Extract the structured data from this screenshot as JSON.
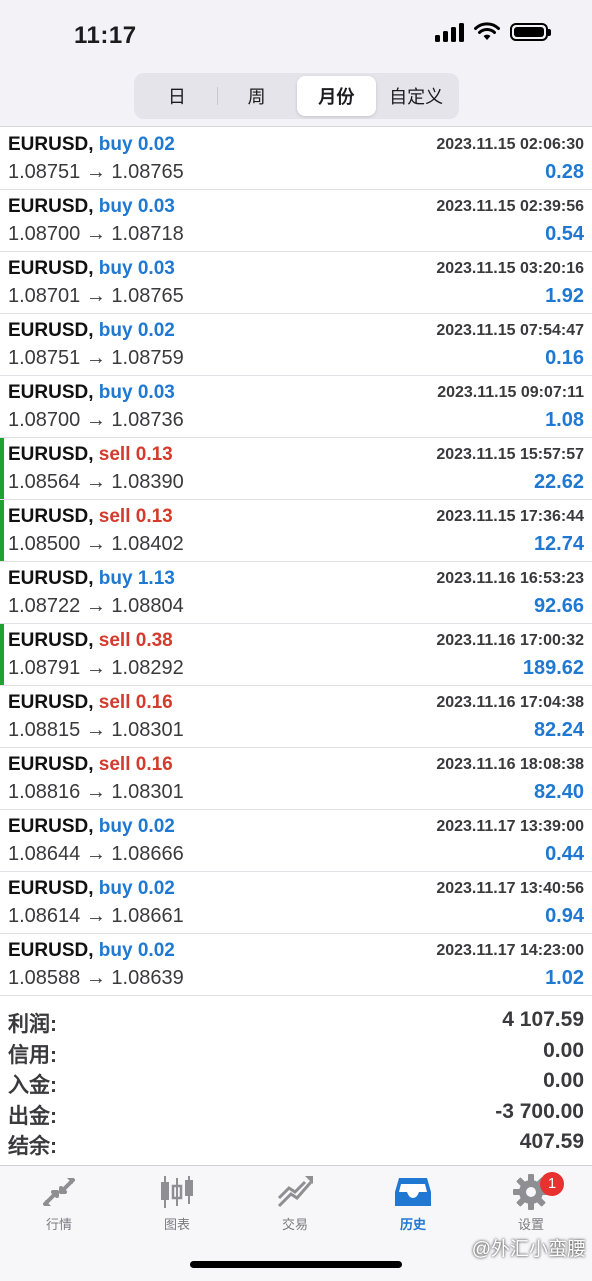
{
  "status": {
    "time": "11:17"
  },
  "segments": [
    "日",
    "周",
    "月份",
    "自定义"
  ],
  "active_segment": "月份",
  "trades": [
    {
      "symbol": "EURUSD,",
      "side": "buy",
      "volume": "0.02",
      "side_label": "buy 0.02",
      "datetime": "2023.11.15 02:06:30",
      "prices": "1.08751 → 1.08765",
      "profit": "0.28",
      "marked": false
    },
    {
      "symbol": "EURUSD,",
      "side": "buy",
      "volume": "0.03",
      "side_label": "buy 0.03",
      "datetime": "2023.11.15 02:39:56",
      "prices": "1.08700 → 1.08718",
      "profit": "0.54",
      "marked": false
    },
    {
      "symbol": "EURUSD,",
      "side": "buy",
      "volume": "0.03",
      "side_label": "buy 0.03",
      "datetime": "2023.11.15 03:20:16",
      "prices": "1.08701 → 1.08765",
      "profit": "1.92",
      "marked": false
    },
    {
      "symbol": "EURUSD,",
      "side": "buy",
      "volume": "0.02",
      "side_label": "buy 0.02",
      "datetime": "2023.11.15 07:54:47",
      "prices": "1.08751 → 1.08759",
      "profit": "0.16",
      "marked": false
    },
    {
      "symbol": "EURUSD,",
      "side": "buy",
      "volume": "0.03",
      "side_label": "buy 0.03",
      "datetime": "2023.11.15 09:07:11",
      "prices": "1.08700 → 1.08736",
      "profit": "1.08",
      "marked": false
    },
    {
      "symbol": "EURUSD,",
      "side": "sell",
      "volume": "0.13",
      "side_label": "sell 0.13",
      "datetime": "2023.11.15 15:57:57",
      "prices": "1.08564 → 1.08390",
      "profit": "22.62",
      "marked": true
    },
    {
      "symbol": "EURUSD,",
      "side": "sell",
      "volume": "0.13",
      "side_label": "sell 0.13",
      "datetime": "2023.11.15 17:36:44",
      "prices": "1.08500 → 1.08402",
      "profit": "12.74",
      "marked": true
    },
    {
      "symbol": "EURUSD,",
      "side": "buy",
      "volume": "1.13",
      "side_label": "buy 1.13",
      "datetime": "2023.11.16 16:53:23",
      "prices": "1.08722 → 1.08804",
      "profit": "92.66",
      "marked": false
    },
    {
      "symbol": "EURUSD,",
      "side": "sell",
      "volume": "0.38",
      "side_label": "sell 0.38",
      "datetime": "2023.11.16 17:00:32",
      "prices": "1.08791 → 1.08292",
      "profit": "189.62",
      "marked": true
    },
    {
      "symbol": "EURUSD,",
      "side": "sell",
      "volume": "0.16",
      "side_label": "sell 0.16",
      "datetime": "2023.11.16 17:04:38",
      "prices": "1.08815 → 1.08301",
      "profit": "82.24",
      "marked": false
    },
    {
      "symbol": "EURUSD,",
      "side": "sell",
      "volume": "0.16",
      "side_label": "sell 0.16",
      "datetime": "2023.11.16 18:08:38",
      "prices": "1.08816 → 1.08301",
      "profit": "82.40",
      "marked": false
    },
    {
      "symbol": "EURUSD,",
      "side": "buy",
      "volume": "0.02",
      "side_label": "buy 0.02",
      "datetime": "2023.11.17 13:39:00",
      "prices": "1.08644 → 1.08666",
      "profit": "0.44",
      "marked": false
    },
    {
      "symbol": "EURUSD,",
      "side": "buy",
      "volume": "0.02",
      "side_label": "buy 0.02",
      "datetime": "2023.11.17 13:40:56",
      "prices": "1.08614 → 1.08661",
      "profit": "0.94",
      "marked": false
    },
    {
      "symbol": "EURUSD,",
      "side": "buy",
      "volume": "0.02",
      "side_label": "buy 0.02",
      "datetime": "2023.11.17 14:23:00",
      "prices": "1.08588 → 1.08639",
      "profit": "1.02",
      "marked": false
    }
  ],
  "summary": [
    {
      "label": "利润:",
      "value": "4 107.59"
    },
    {
      "label": "信用:",
      "value": "0.00"
    },
    {
      "label": "入金:",
      "value": "0.00"
    },
    {
      "label": "出金:",
      "value": "-3 700.00"
    },
    {
      "label": "结余:",
      "value": "407.59"
    }
  ],
  "tabs": [
    {
      "label": "行情",
      "icon": "quotes-icon",
      "active": false
    },
    {
      "label": "图表",
      "icon": "chart-icon",
      "active": false
    },
    {
      "label": "交易",
      "icon": "trade-icon",
      "active": false
    },
    {
      "label": "历史",
      "icon": "history-icon",
      "active": true
    },
    {
      "label": "设置",
      "icon": "gear-icon",
      "active": false,
      "badge": "1"
    }
  ],
  "watermark": "@外汇小蛮腰",
  "colors": {
    "buy": "#1f78d1",
    "sell": "#d43b2c",
    "profit": "#1f78d1",
    "marker": "#21a12f",
    "badge": "#e8322f"
  }
}
